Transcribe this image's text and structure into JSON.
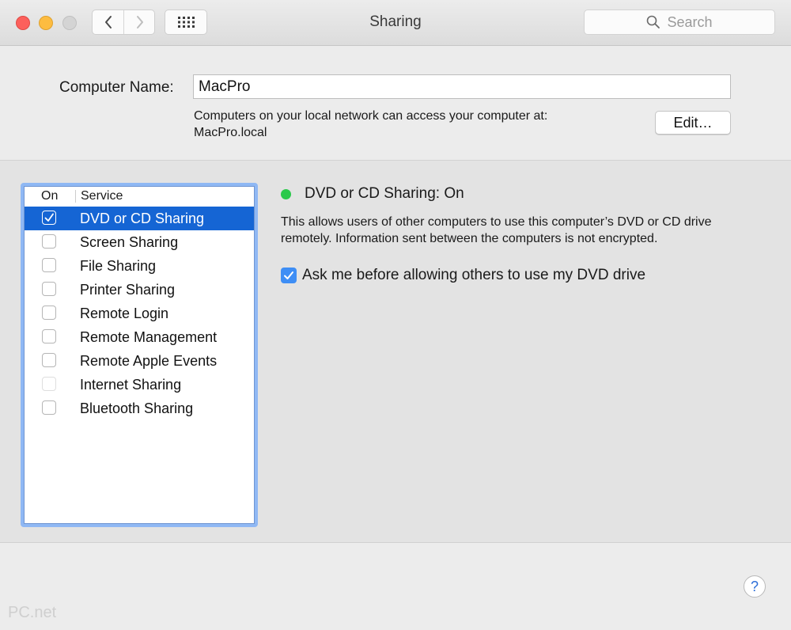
{
  "window": {
    "title": "Sharing"
  },
  "toolbar": {
    "search_placeholder": "Search",
    "back_icon": "chevron-left-icon",
    "forward_icon": "chevron-right-icon",
    "show_all_icon": "grid-icon"
  },
  "computer": {
    "name_label": "Computer Name:",
    "name_value": "MacPro",
    "info_line1": "Computers on your local network can access your computer at:",
    "info_line2": "MacPro.local",
    "edit_label": "Edit…"
  },
  "services": {
    "header_on": "On",
    "header_service": "Service",
    "items": [
      {
        "label": "DVD or CD Sharing",
        "checked": true,
        "selected": true,
        "enabled": true
      },
      {
        "label": "Screen Sharing",
        "checked": false,
        "selected": false,
        "enabled": true
      },
      {
        "label": "File Sharing",
        "checked": false,
        "selected": false,
        "enabled": true
      },
      {
        "label": "Printer Sharing",
        "checked": false,
        "selected": false,
        "enabled": true
      },
      {
        "label": "Remote Login",
        "checked": false,
        "selected": false,
        "enabled": true
      },
      {
        "label": "Remote Management",
        "checked": false,
        "selected": false,
        "enabled": true
      },
      {
        "label": "Remote Apple Events",
        "checked": false,
        "selected": false,
        "enabled": true
      },
      {
        "label": "Internet Sharing",
        "checked": false,
        "selected": false,
        "enabled": false
      },
      {
        "label": "Bluetooth Sharing",
        "checked": false,
        "selected": false,
        "enabled": true
      }
    ]
  },
  "detail": {
    "status_text": "DVD or CD Sharing: On",
    "status_color": "#2ac94a",
    "description_line1": "This allows users of other computers to use this computer’s DVD or CD drive",
    "description_line2": "remotely. Information sent between the computers is not encrypted.",
    "ask_label": "Ask me before allowing others to use my DVD drive",
    "ask_checked": true
  },
  "footer": {
    "help_label": "?",
    "watermark": "PC.net"
  },
  "colors": {
    "selection": "#1565d4",
    "focus_ring": "#8fb8f4",
    "checkbox_blue": "#3e8ef5"
  }
}
